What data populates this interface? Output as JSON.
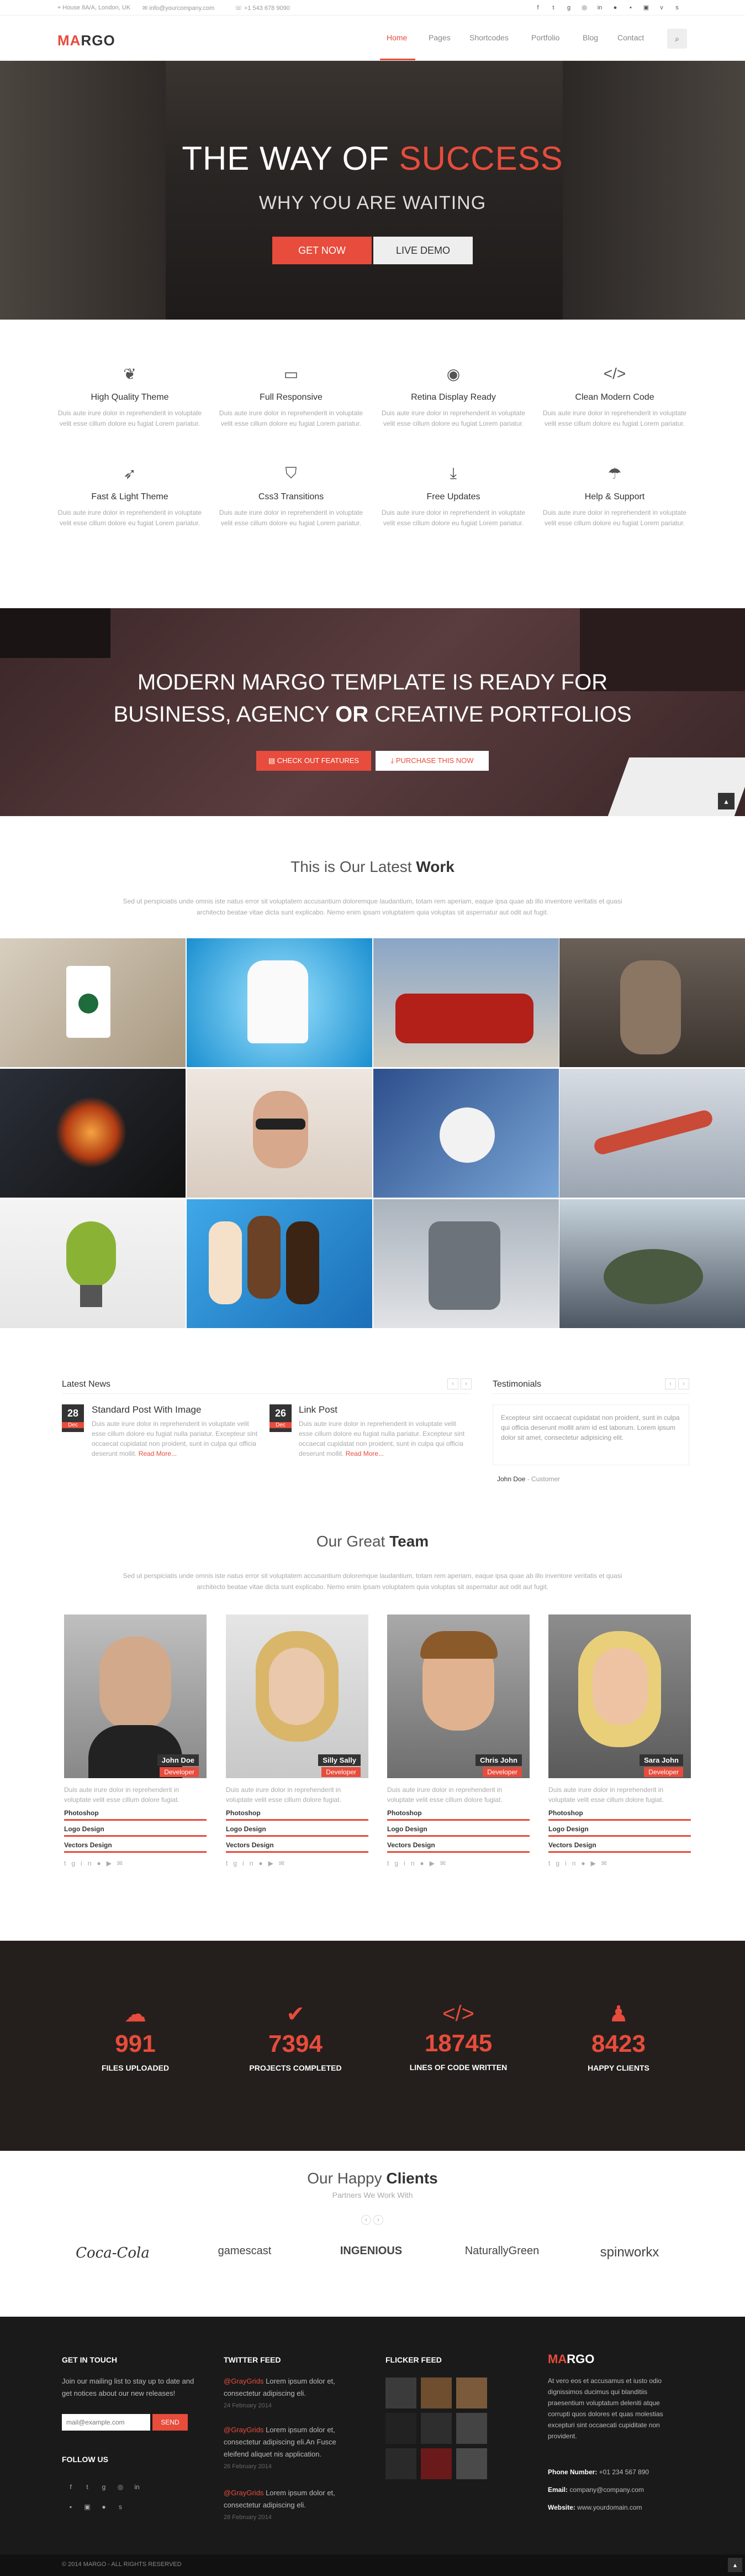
{
  "topbar": {
    "address": "House 8A/A, London, UK",
    "email": "info@yourcompany.com",
    "phone": "+1 543 678 9090",
    "social_icons": [
      "facebook-icon",
      "twitter-icon",
      "google-plus-icon",
      "dribbble-icon",
      "linkedin-icon",
      "flickr-icon",
      "tumblr-icon",
      "instagram-icon",
      "vimeo-icon",
      "skype-icon"
    ]
  },
  "nav": {
    "logo_first": "MA",
    "logo_rest": "RGO",
    "items": [
      "Home",
      "Pages",
      "Shortcodes",
      "Portfolio",
      "Blog",
      "Contact"
    ]
  },
  "hero": {
    "title_white": "THE WAY OF ",
    "title_red": "SUCCESS",
    "subtitle": "WHY YOU ARE WAITING",
    "btn_primary": "GET NOW",
    "btn_secondary": "LIVE DEMO"
  },
  "features": [
    {
      "icon": "leaf-icon",
      "title": "High Quality Theme",
      "desc": "Duis aute irure dolor in reprehenderit in voluptate velit esse cillum dolore eu fugiat Lorem pariatur."
    },
    {
      "icon": "monitor-icon",
      "title": "Full Responsive",
      "desc": "Duis aute irure dolor in reprehenderit in voluptate velit esse cillum dolore eu fugiat Lorem pariatur."
    },
    {
      "icon": "eye-icon",
      "title": "Retina Display Ready",
      "desc": "Duis aute irure dolor in reprehenderit in voluptate velit esse cillum dolore eu fugiat Lorem pariatur."
    },
    {
      "icon": "code-icon",
      "title": "Clean Modern Code",
      "desc": "Duis aute irure dolor in reprehenderit in voluptate velit esse cillum dolore eu fugiat Lorem pariatur."
    },
    {
      "icon": "rocket-icon",
      "title": "Fast & Light Theme",
      "desc": "Duis aute irure dolor in reprehenderit in voluptate velit esse cillum dolore eu fugiat Lorem pariatur."
    },
    {
      "icon": "css3-icon",
      "title": "Css3 Transitions",
      "desc": "Duis aute irure dolor in reprehenderit in voluptate velit esse cillum dolore eu fugiat Lorem pariatur."
    },
    {
      "icon": "download-icon",
      "title": "Free Updates",
      "desc": "Duis aute irure dolor in reprehenderit in voluptate velit esse cillum dolore eu fugiat Lorem pariatur."
    },
    {
      "icon": "umbrella-icon",
      "title": "Help & Support",
      "desc": "Duis aute irure dolor in reprehenderit in voluptate velit esse cillum dolore eu fugiat Lorem pariatur."
    }
  ],
  "banner": {
    "line1": "MODERN MARGO TEMPLATE IS READY FOR",
    "line2_a": "BUSINESS, AGENCY ",
    "line2_b": "OR",
    "line2_c": " CREATIVE PORTFOLIOS",
    "btn_primary": "CHECK OUT FEATURES",
    "btn_secondary": "PURCHASE THIS NOW"
  },
  "work": {
    "title_a": "This is Our Latest ",
    "title_b": "Work",
    "desc": "Sed ut perspiciatis unde omnis iste natus error sit voluptatem accusantium doloremque laudantium, totam rem aperiam, eaque ipsa quae ab illo inventore veritatis et quasi architecto beatae vitae dicta sunt explicabo. Nemo enim ipsam voluptatem quia voluptas sit aspernatur aut odit aut fugit.",
    "items": [
      "starbucks-cup",
      "listerine-tooth",
      "red-car",
      "sports-player",
      "time-shift-explosion",
      "glasses-man",
      "soccer-ball",
      "jet-plane",
      "bulb-apple",
      "ice-creams",
      "robot-mech",
      "frog-creature"
    ]
  },
  "news": {
    "heading": "Latest News",
    "posts": [
      {
        "day": "28",
        "month": "Dec",
        "title": "Standard Post With Image",
        "text": "Duis aute irure dolor in reprehenderit in voluptate velit esse cillum dolore eu fugiat nulla pariatur. Excepteur sint occaecat cupidatat non proident, sunt in culpa qui officia deserunt mollit.",
        "more": "Read More..."
      },
      {
        "day": "26",
        "month": "Dec",
        "title": "Link Post",
        "text": "Duis aute irure dolor in reprehenderit in voluptate velit esse cillum dolore eu fugiat nulla pariatur. Excepteur sint occaecat cupidatat non proident, sunt in culpa qui officia deserunt mollit.",
        "more": "Read More..."
      }
    ]
  },
  "testimonials": {
    "heading": "Testimonials",
    "quote": "Excepteur sint occaecat cupidatat non proident, sunt in culpa qui officia deserunt mollit anim id est laborum. Lorem ipsum dolor sit amet, consectetur adipisicing elit.",
    "author": "John Doe",
    "role": " - Customer"
  },
  "team": {
    "title_a": "Our Great ",
    "title_b": "Team",
    "desc": "Sed ut perspiciatis unde omnis iste natus error sit voluptatem accusantium doloremque laudantium, totam rem aperiam, eaque ipsa quae ab illo inventore veritatis et quasi architecto beatae vitae dicta sunt explicabo. Nemo enim ipsam voluptatem quia voluptas sit aspernatur aut odit aut fugit.",
    "members": [
      {
        "name": "John Doe",
        "role": "Developer",
        "desc": "Duis aute irure dolor in reprehenderit in voluptate velit esse cillum dolore fugiat."
      },
      {
        "name": "Silly Sally",
        "role": "Developer",
        "desc": "Duis aute irure dolor in reprehenderit in voluptate velit esse cillum dolore fugiat."
      },
      {
        "name": "Chris John",
        "role": "Developer",
        "desc": "Duis aute irure dolor in reprehenderit in voluptate velit esse cillum dolore fugiat."
      },
      {
        "name": "Sara John",
        "role": "Developer",
        "desc": "Duis aute irure dolor in reprehenderit in voluptate velit esse cillum dolore fugiat."
      }
    ],
    "skills": [
      "Photoshop",
      "Logo Design",
      "Vectors Design"
    ],
    "social": [
      "twitter-icon",
      "google-plus-icon",
      "linkedin-icon",
      "flickr-icon",
      "youtube-icon",
      "email-icon"
    ]
  },
  "stats": [
    {
      "icon": "cloud-upload-icon",
      "value": "991",
      "label": "FILES UPLOADED"
    },
    {
      "icon": "check-icon",
      "value": "7394",
      "label": "PROJECTS COMPLETED"
    },
    {
      "icon": "code-icon",
      "value": "18745",
      "label": "LINES OF CODE WRITTEN"
    },
    {
      "icon": "male-icon",
      "value": "8423",
      "label": "HAPPY CLIENTS"
    }
  ],
  "clients": {
    "title_a": "Our Happy ",
    "title_b": "Clients",
    "subtitle": "Partners We Work With",
    "logos": [
      "Coca-Cola",
      "gamescast",
      "INGENIOUS",
      "NaturallyGreen",
      "spinworkx"
    ]
  },
  "footer": {
    "touch_heading": "GET IN TOUCH",
    "touch_text": "Join our mailing list to stay up to date and get notices about our new releases!",
    "email_placeholder": "mail@example.com",
    "signup": "SEND",
    "follow_heading": "FOLLOW US",
    "twitter_heading": "TWITTER FEED",
    "tweets": [
      {
        "handle": "@GrayGrids",
        "text": "Lorem ipsum dolor et, consectetur adipiscing eli.",
        "date": "24 February 2014"
      },
      {
        "handle": "@GrayGrids",
        "text": "Lorem ipsum dolor et, consectetur adipiscing eli.An Fusce eleifend aliquet nis application.",
        "date": "26 February 2014"
      },
      {
        "handle": "@GrayGrids",
        "text": "Lorem ipsum dolor et, consectetur adipiscing eli.",
        "date": "28 February 2014"
      }
    ],
    "flickr_heading": "FLICKER FEED",
    "about_logo_a": "MA",
    "about_logo_b": "RGO",
    "about_text": "At vero eos et accusamus et iusto odio dignissimos ducimus qui blanditiis praesentium voluptatum deleniti atque corrupti quos dolores et quas molestias excepturi sint occaecati cupiditate non provident.",
    "phone_label": "Phone Number:",
    "phone": " +01 234 567 890",
    "email_label": "Email:",
    "email": " company@company.com",
    "website_label": "Website:",
    "website": " www.yourdomain.com",
    "copyright": "© 2014 MARGO - ALL RIGHTS RESERVED"
  }
}
